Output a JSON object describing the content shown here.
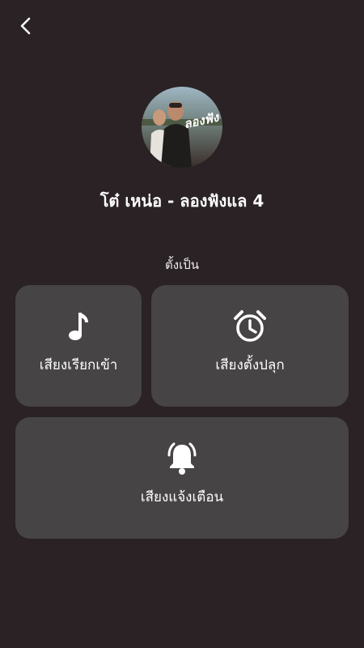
{
  "header": {
    "back_icon": "chevron-left-icon"
  },
  "song": {
    "title": "โต๋ เหน่อ - ลองฟังแล 4",
    "cover_icon": "album-cover",
    "cover_art_text": "ลองฟัง"
  },
  "set_as": {
    "label": "ตั้งเป็น",
    "options": [
      {
        "label": "เสียงเรียกเข้า",
        "icon": "music-note-icon"
      },
      {
        "label": "เสียงตั้งปลุก",
        "icon": "alarm-clock-icon"
      },
      {
        "label": "เสียงแจ้งเตือน",
        "icon": "bell-ring-icon"
      }
    ]
  },
  "colors": {
    "background": "#2a2225",
    "card": "#464444",
    "text": "#ffffff"
  }
}
